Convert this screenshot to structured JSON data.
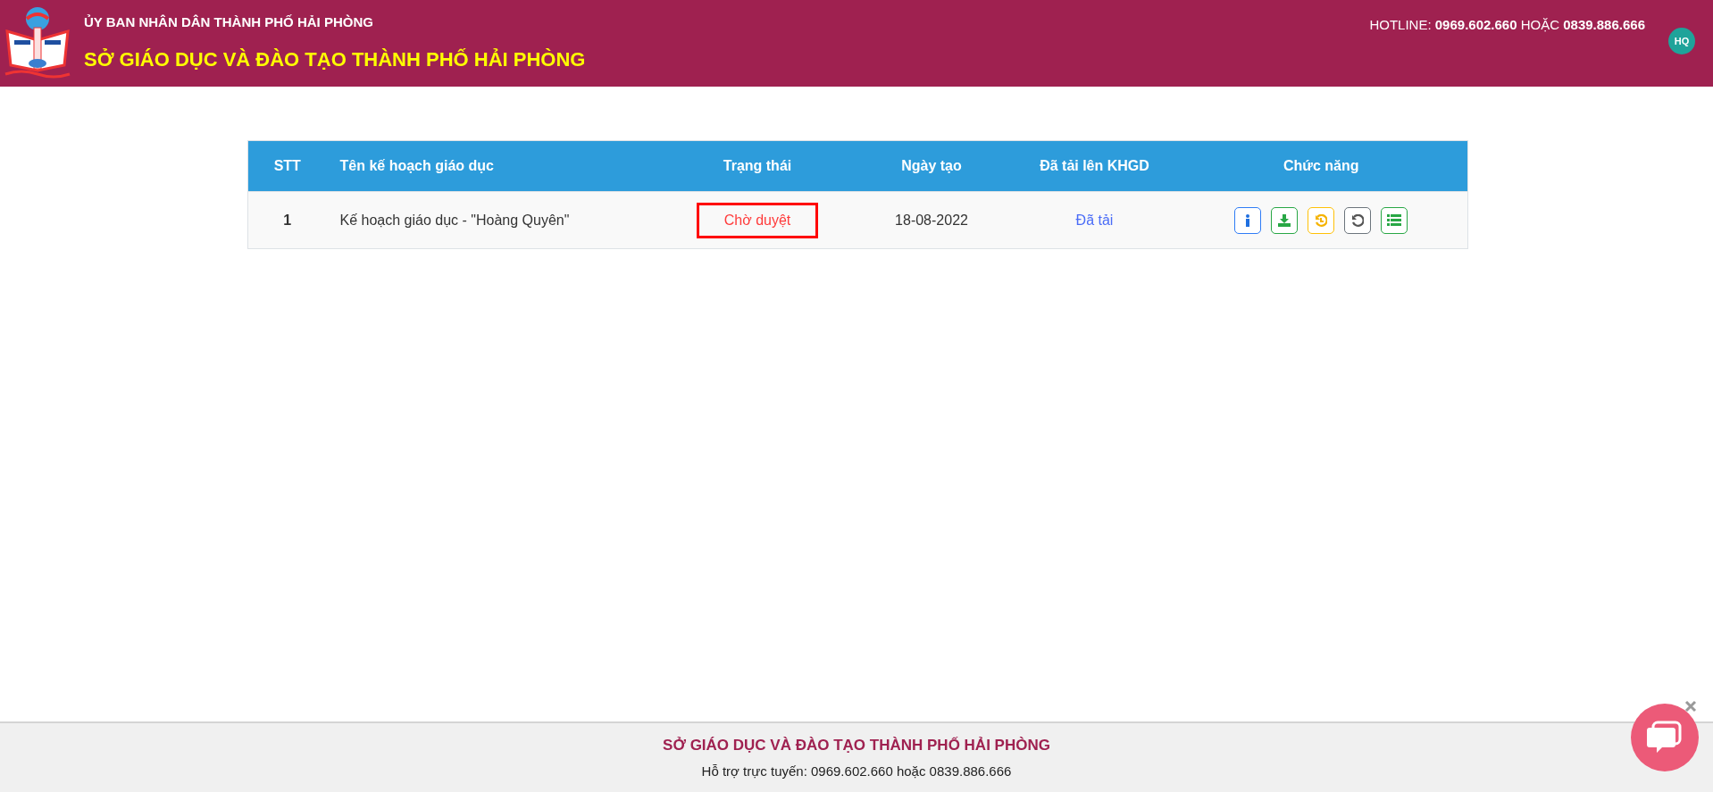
{
  "header": {
    "org": "ỦY BAN NHÂN DÂN THÀNH PHỐ HẢI PHÒNG",
    "title": "SỞ GIÁO DỤC VÀ ĐÀO TẠO THÀNH PHỐ HẢI PHÒNG",
    "hotline": "HOTLINE: **0969.602.660** HOẶC **0839.886.666**",
    "avatar": "HQ"
  },
  "table": {
    "columns": [
      "STT",
      "Tên kế hoạch giáo dục",
      "Trạng thái",
      "Ngày tạo",
      "Đã tải lên KHGD",
      "Chức năng"
    ],
    "rows": [
      {
        "stt": "1",
        "name": "Kế hoạch giáo dục - \"Hoàng Quyên\"",
        "status": "Chờ duyệt",
        "date": "18-08-2022",
        "uploaded": "Đã tải",
        "actions": [
          {
            "kind": "info"
          },
          {
            "kind": "download"
          },
          {
            "kind": "history"
          },
          {
            "kind": "undo"
          },
          {
            "kind": "list"
          }
        ]
      }
    ]
  },
  "footer": {
    "title": "SỞ GIÁO DỤC VÀ ĐÀO TẠO THÀNH PHỐ HẢI PHÒNG",
    "support": "Hỗ trợ trực tuyến: 0969.602.660 hoặc 0839.886.666"
  }
}
